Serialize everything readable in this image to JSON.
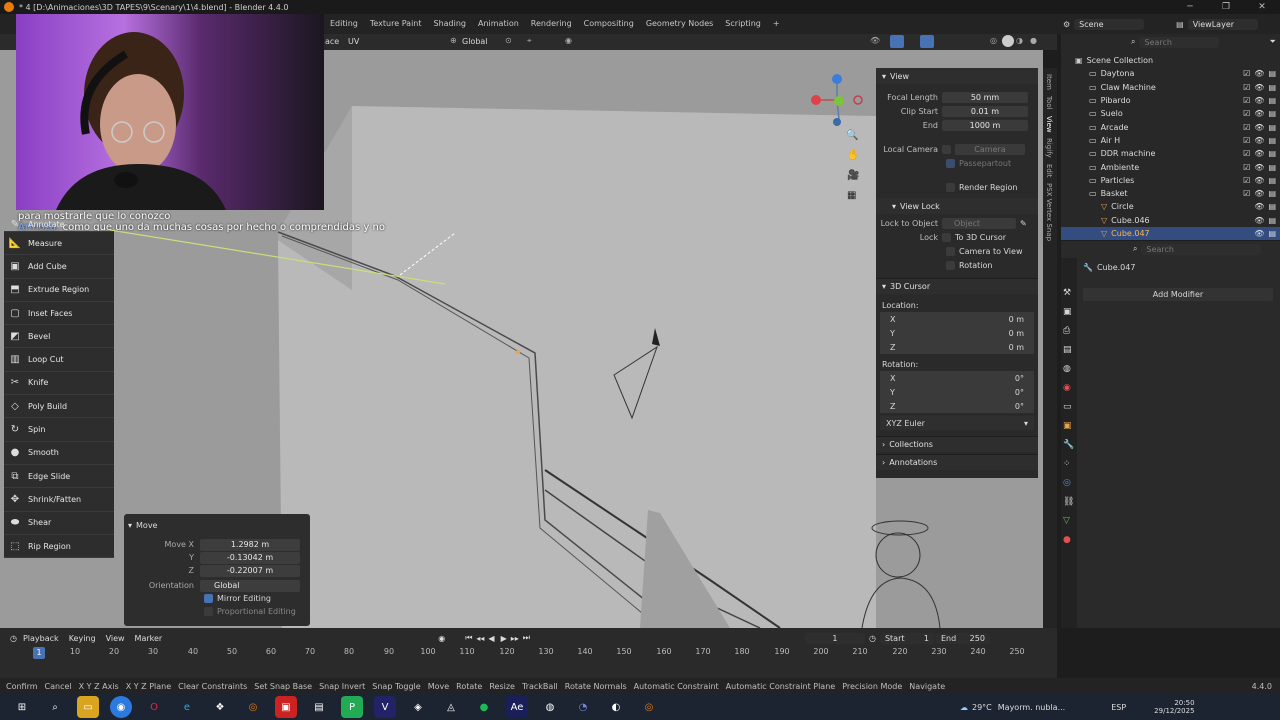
{
  "window": {
    "title": "* 4 [D:\\Animaciones\\3D TAPES\\9\\Scenary\\1\\4.blend] - Blender 4.4.0"
  },
  "menu": {
    "workspaces": [
      "Editing",
      "Texture Paint",
      "Shading",
      "Animation",
      "Rendering",
      "Compositing",
      "Geometry Nodes",
      "Scripting",
      "+"
    ]
  },
  "header": {
    "mode_fragments": [
      "ace",
      "UV"
    ],
    "orientation": "Global"
  },
  "top_right": {
    "scene": "Scene",
    "view_layer": "ViewLayer"
  },
  "chat": {
    "line1": "para mostrarle que lo conozco",
    "user": "Armoza:",
    "line2": "como que uno da muchas cosas por hecho o comprendidas y no"
  },
  "toolbar": {
    "items": [
      "Annotate",
      "Measure",
      "Add Cube",
      "Extrude Region",
      "Inset Faces",
      "Bevel",
      "Loop Cut",
      "Knife",
      "Poly Build",
      "Spin",
      "Smooth",
      "Edge Slide",
      "Shrink/Fatten",
      "Shear",
      "Rip Region"
    ]
  },
  "move_panel": {
    "title": "Move",
    "move_x_label": "Move X",
    "move_x": "1.2982 m",
    "y_label": "Y",
    "y": "-0.13042 m",
    "z_label": "Z",
    "z": "-0.22007 m",
    "orientation_label": "Orientation",
    "orientation": "Global",
    "mirror_label": "Mirror Editing",
    "proportional_label": "Proportional Editing"
  },
  "npanel": {
    "view_header": "View",
    "focal_label": "Focal Length",
    "focal": "50 mm",
    "clip_start_label": "Clip Start",
    "clip_start": "0.01 m",
    "end_label": "End",
    "end": "1000 m",
    "local_camera_label": "Local Camera",
    "camera": "Camera",
    "passepartout": "Passepartout",
    "render_region": "Render Region",
    "view_lock_header": "View Lock",
    "lock_to_object_label": "Lock to Object",
    "object_placeholder": "Object",
    "lock_label": "Lock",
    "to_3d_cursor": "To 3D Cursor",
    "camera_to_view": "Camera to View",
    "rotation_lock": "Rotation",
    "cursor_header": "3D Cursor",
    "location_label": "Location:",
    "loc_x_label": "X",
    "loc_x": "0 m",
    "loc_y_label": "Y",
    "loc_y": "0 m",
    "loc_z_label": "Z",
    "loc_z": "0 m",
    "rotation_label": "Rotation:",
    "rot_x_label": "X",
    "rot_x": "0°",
    "rot_y_label": "Y",
    "rot_y": "0°",
    "rot_z_label": "Z",
    "rot_z": "0°",
    "euler": "XYZ Euler",
    "collections_header": "Collections",
    "annotations_header": "Annotations",
    "side_tabs": [
      "Item",
      "Tool",
      "View",
      "Rigify",
      "Edit",
      "PSX Vertex Snap"
    ]
  },
  "outliner": {
    "search_placeholder": "Search",
    "root": "Scene Collection",
    "rows": [
      "Daytona",
      "Claw Machine",
      "Pibardo",
      "Suelo",
      "Arcade",
      "Air H",
      "DDR machine",
      "Ambiente",
      "Particles",
      "Basket",
      "Circle",
      "Cube.046",
      "Cube.047"
    ],
    "selected": "Cube.047"
  },
  "properties": {
    "search_placeholder": "Search",
    "object_name": "Cube.047",
    "add_modifier": "Add Modifier"
  },
  "timeline": {
    "playback": "Playback",
    "keying": "Keying",
    "view": "View",
    "marker": "Marker",
    "current_frame": "1",
    "start_label": "Start",
    "start": "1",
    "end_label": "End",
    "end": "250",
    "frame_labels": [
      "10",
      "20",
      "30",
      "40",
      "50",
      "60",
      "70",
      "80",
      "90",
      "100",
      "110",
      "120",
      "130",
      "140",
      "150",
      "160",
      "170",
      "180",
      "190",
      "200",
      "210",
      "220",
      "230",
      "240",
      "250"
    ],
    "current_marker": "1"
  },
  "statusbar": {
    "items": [
      "Confirm",
      "Cancel",
      "X Y Z Axis",
      "X Y Z Plane",
      "Clear Constraints",
      "Set Snap Base",
      "Snap Invert",
      "Snap Toggle",
      "Move",
      "Rotate",
      "Resize",
      "TrackBall",
      "Rotate Normals",
      "Automatic Constraint",
      "Automatic Constraint Plane",
      "Precision Mode",
      "Navigate"
    ],
    "version": "4.4.0"
  },
  "taskbar": {
    "weather": "29°C",
    "weather_text": "Mayorm. nubla...",
    "lang": "ESP",
    "time": "20:50",
    "date": "29/12/2025"
  },
  "colors": {
    "accent": "#4772b3",
    "selected_row": "#334d80",
    "object_orange": "#e5a550"
  }
}
